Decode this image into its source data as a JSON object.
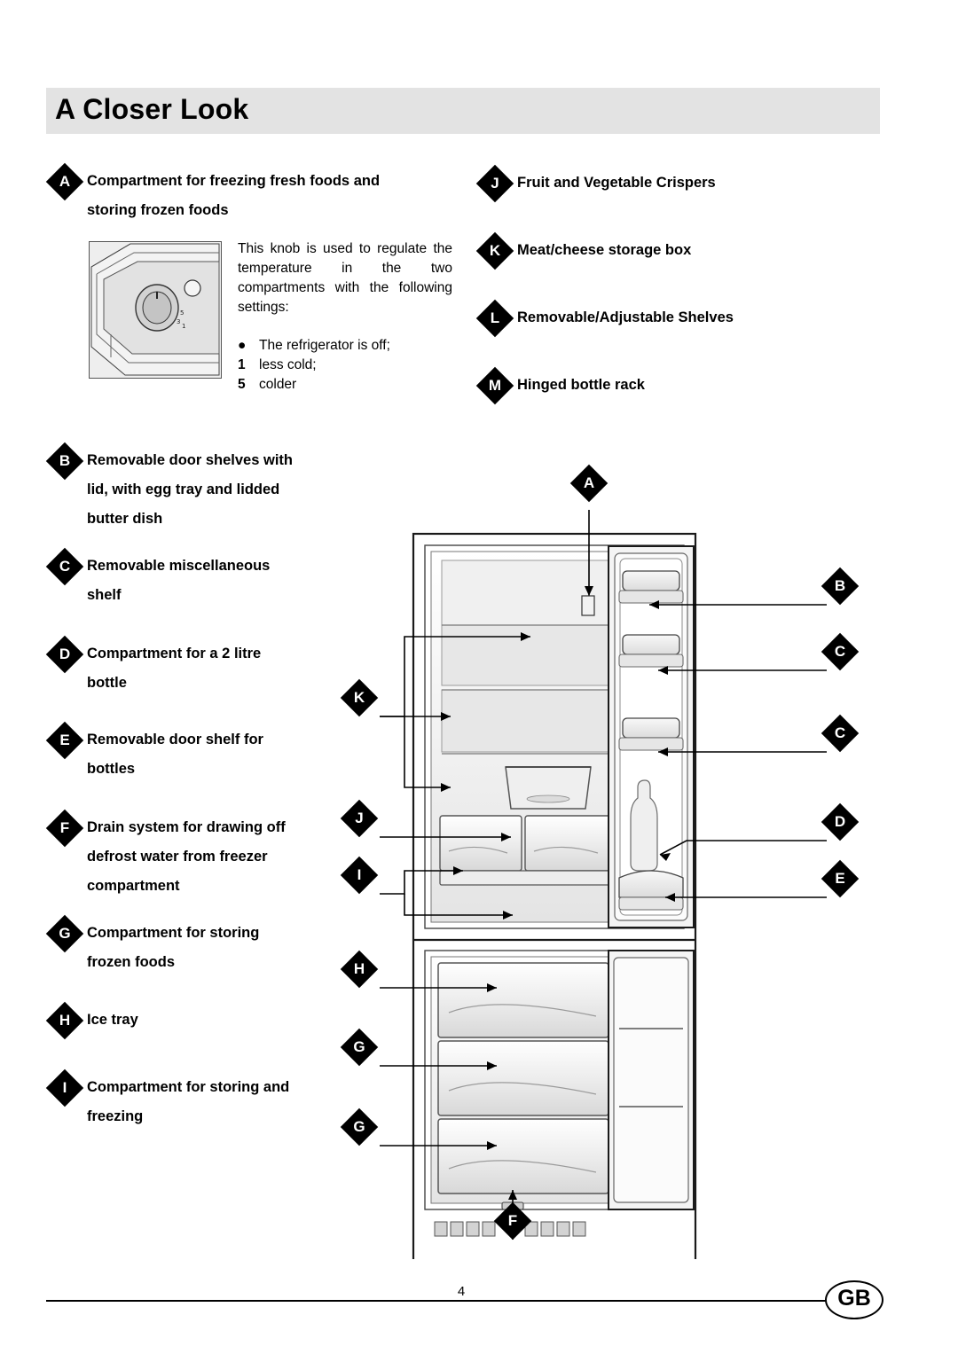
{
  "page": {
    "title": "A Closer Look",
    "page_number": "4",
    "language_badge": "GB"
  },
  "knob": {
    "description": "This knob is used to regulate the temperature in the two compartments with the following settings:",
    "settings": [
      {
        "key": "●",
        "label": "The refrigerator is off;"
      },
      {
        "key": "1",
        "label": "less cold;"
      },
      {
        "key": "5",
        "label": "colder"
      }
    ]
  },
  "legend_left": [
    {
      "letter": "A",
      "text": "Compartment for freezing fresh foods and\nstoring frozen foods"
    },
    {
      "letter": "B",
      "text": "Removable door shelves with\nlid, with egg tray and lidded\nbutter dish"
    },
    {
      "letter": "C",
      "text": "Removable miscellaneous\nshelf"
    },
    {
      "letter": "D",
      "text": "Compartment for a 2 litre\nbottle"
    },
    {
      "letter": "E",
      "text": "Removable door shelf for\nbottles"
    },
    {
      "letter": "F",
      "text": "Drain system for drawing off\ndefrost water from freezer\ncompartment"
    },
    {
      "letter": "G",
      "text": "Compartment for storing\nfrozen foods"
    },
    {
      "letter": "H",
      "text": "Ice tray"
    },
    {
      "letter": "I",
      "text": "Compartment for storing and\nfreezing"
    }
  ],
  "legend_right": [
    {
      "letter": "J",
      "text": "Fruit and Vegetable Crispers"
    },
    {
      "letter": "K",
      "text": "Meat/cheese storage box"
    },
    {
      "letter": "L",
      "text": "Removable/Adjustable Shelves"
    },
    {
      "letter": "M",
      "text": "Hinged bottle rack"
    }
  ],
  "diagram_callouts": [
    {
      "letter": "A"
    },
    {
      "letter": "B"
    },
    {
      "letter": "C"
    },
    {
      "letter": "C"
    },
    {
      "letter": "D"
    },
    {
      "letter": "E"
    },
    {
      "letter": "F"
    },
    {
      "letter": "G"
    },
    {
      "letter": "G"
    },
    {
      "letter": "H"
    },
    {
      "letter": "I"
    },
    {
      "letter": "J"
    },
    {
      "letter": "K"
    }
  ]
}
